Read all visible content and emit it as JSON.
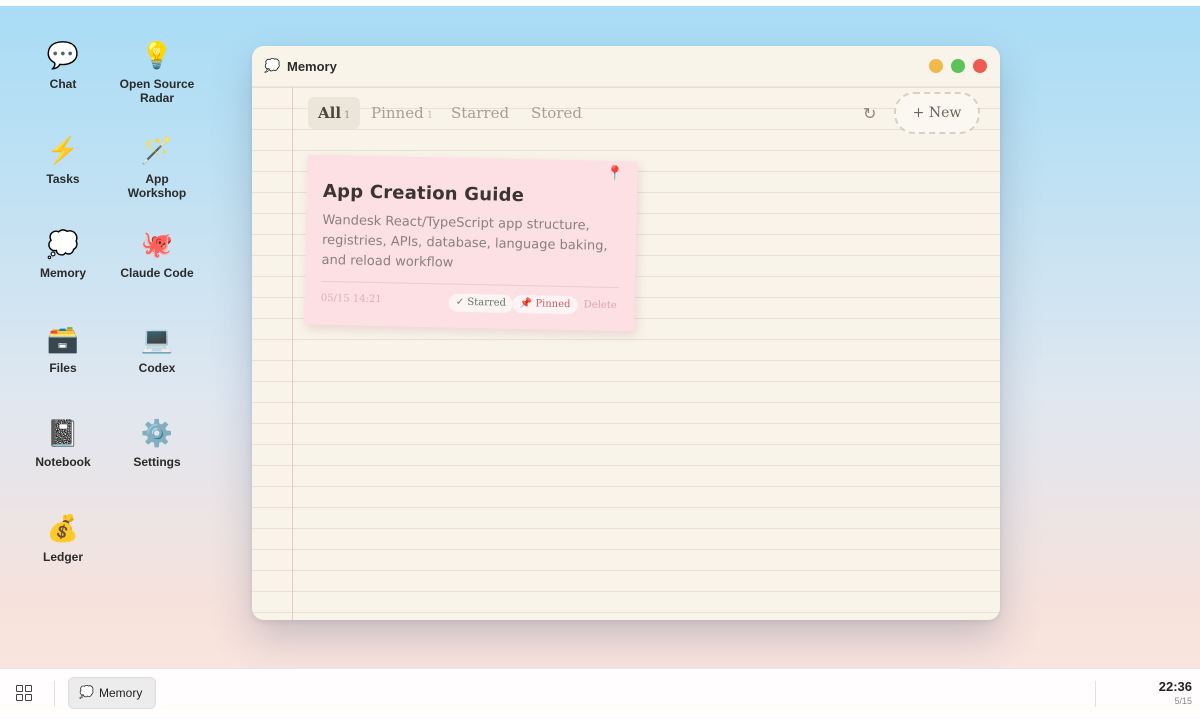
{
  "desktop": {
    "icons": [
      {
        "label": "Chat",
        "glyph": "💬",
        "icon": "chat-bubble-icon"
      },
      {
        "label": "Open Source Radar",
        "glyph": "💡",
        "icon": "lightbulb-icon"
      },
      {
        "label": "Tasks",
        "glyph": "⚡",
        "icon": "lightning-icon"
      },
      {
        "label": "App Workshop",
        "glyph": "🪄",
        "icon": "magic-wand-icon"
      },
      {
        "label": "Memory",
        "glyph": "💭",
        "icon": "thought-bubble-icon"
      },
      {
        "label": "Claude Code",
        "glyph": "🐙",
        "icon": "octopus-icon"
      },
      {
        "label": "Files",
        "glyph": "🗃️",
        "icon": "file-box-icon"
      },
      {
        "label": "Codex",
        "glyph": "💻",
        "icon": "laptop-icon"
      },
      {
        "label": "Notebook",
        "glyph": "📓",
        "icon": "notebook-icon"
      },
      {
        "label": "Settings",
        "glyph": "⚙️",
        "icon": "gear-icon"
      },
      {
        "label": "Ledger",
        "glyph": "💰",
        "icon": "money-bag-icon"
      }
    ]
  },
  "window": {
    "title": "Memory",
    "app_glyph": "💭",
    "tabs": [
      {
        "label": "All",
        "count": "1",
        "active": true
      },
      {
        "label": "Pinned",
        "count": "1",
        "active": false
      },
      {
        "label": "Starred",
        "count": "",
        "active": false
      },
      {
        "label": "Stored",
        "count": "",
        "active": false
      }
    ],
    "refresh_glyph": "↻",
    "new_label": "+ New",
    "note": {
      "pin_glyph": "📍",
      "title": "App Creation Guide",
      "body": "Wandesk React/TypeScript app structure, registries, APIs, database, language baking, and reload workflow",
      "date": "05/15 14:21",
      "starred_label": "✓ Starred",
      "pinned_label": "📌 Pinned",
      "delete_label": "Delete"
    }
  },
  "taskbar": {
    "active_app": "Memory",
    "active_glyph": "💭",
    "time": "22:36",
    "date": "5/15"
  },
  "colors": {
    "note_bg": "#fce0e4",
    "paper_bg": "#f8f4ea",
    "close": "#ee5b52",
    "minimize": "#f0b94a",
    "maximize": "#5cc25a"
  }
}
